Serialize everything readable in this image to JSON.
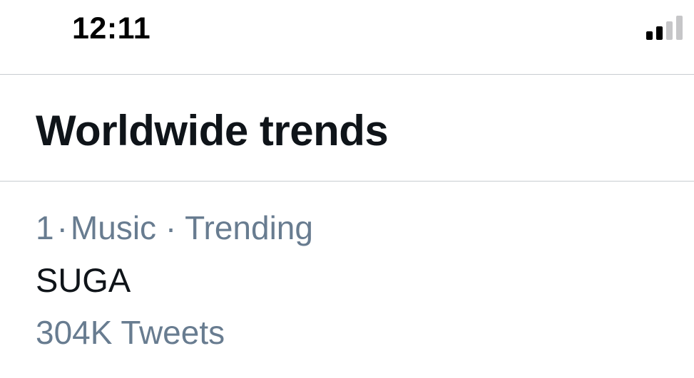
{
  "status_bar": {
    "time": "12:11",
    "signal_icon": "cellular-signal-icon",
    "signal_active_bars": 2,
    "signal_total_bars": 4
  },
  "header": {
    "title": "Worldwide trends"
  },
  "trends": [
    {
      "rank": "1",
      "separator": "·",
      "category": "Music",
      "status": "Trending",
      "name": "SUGA",
      "count": "304K Tweets"
    }
  ],
  "colors": {
    "text_primary": "#0f1419",
    "text_secondary": "#687c90",
    "divider": "#c8ccd0",
    "signal_active": "#000000",
    "signal_inactive": "#c6c6c8"
  }
}
